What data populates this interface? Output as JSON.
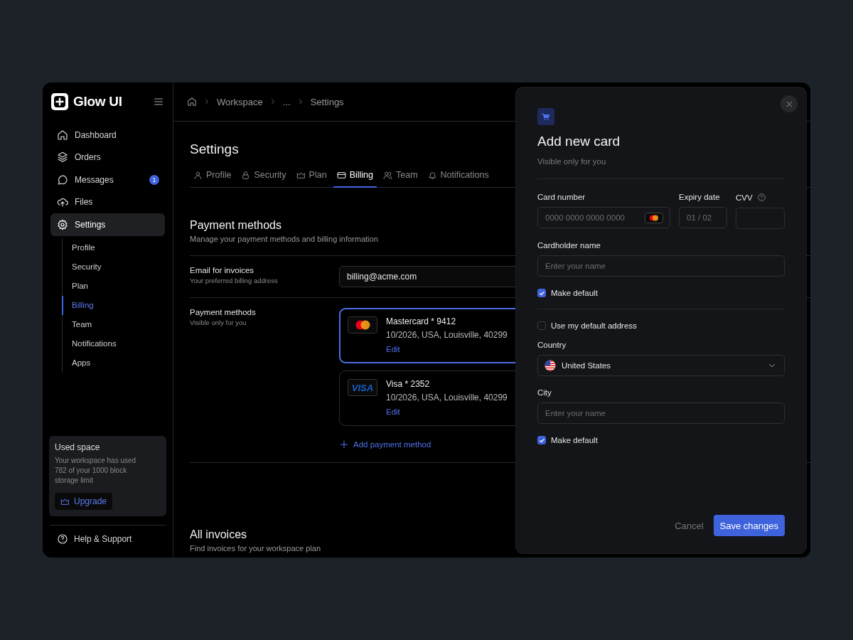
{
  "brand": {
    "name": "Glow UI"
  },
  "nav": [
    {
      "label": "Dashboard",
      "selected": false
    },
    {
      "label": "Orders",
      "selected": false
    },
    {
      "label": "Messages",
      "selected": false,
      "badge": "1"
    },
    {
      "label": "Files",
      "selected": false
    },
    {
      "label": "Settings",
      "selected": true
    }
  ],
  "subnav": [
    {
      "label": "Profile",
      "selected": false
    },
    {
      "label": "Security",
      "selected": false
    },
    {
      "label": "Plan",
      "selected": false
    },
    {
      "label": "Billing",
      "selected": true
    },
    {
      "label": "Team",
      "selected": false
    },
    {
      "label": "Notifications",
      "selected": false
    },
    {
      "label": "Apps",
      "selected": false
    }
  ],
  "usage_card": {
    "title": "Used space",
    "text": "Your workspace has used 782 of your 1000 block storage limit",
    "button": "Upgrade"
  },
  "help": "Help & Support",
  "breadcrumb": [
    "Workspace",
    "...",
    "Settings"
  ],
  "page_title": "Settings",
  "tabs": [
    {
      "label": "Profile",
      "selected": false
    },
    {
      "label": "Security",
      "selected": false
    },
    {
      "label": "Plan",
      "selected": false
    },
    {
      "label": "Billing",
      "selected": true
    },
    {
      "label": "Team",
      "selected": false
    },
    {
      "label": "Notifications",
      "selected": false
    }
  ],
  "payment_section": {
    "title": "Payment methods",
    "subtitle": "Manage your payment methods and billing information",
    "email_row": {
      "label": "Email for invoices",
      "hint": "Your preferred billing address",
      "value": "billing@acme.com"
    },
    "methods_row": {
      "label": "Payment methods",
      "hint": "Visible only for you",
      "cards": [
        {
          "kind": "mastercard",
          "name": "Mastercard * 9412",
          "details": "10/2026, USA, Louisville, 40299",
          "action": "Edit",
          "selected": true
        },
        {
          "kind": "visa",
          "logo_text": "VISA",
          "name": "Visa * 2352",
          "details": "10/2026, USA, Louisville, 40299",
          "action": "Edit",
          "selected": false
        }
      ],
      "add_button": "Add payment method"
    }
  },
  "invoices_section": {
    "title": "All invoices",
    "subtitle": "Find invoices for your workspace plan"
  },
  "dialog": {
    "title": "Add new card",
    "subtitle": "Visible only for you",
    "card_number": {
      "label": "Card number",
      "placeholder": "0000 0000 0000 0000"
    },
    "expiry_date": {
      "label": "Expiry date",
      "placeholder": "01 / 02"
    },
    "cvv": {
      "label": "CVV"
    },
    "cardholder_name": {
      "label": "Cardholder name",
      "placeholder": "Enter your name"
    },
    "card_default": {
      "label": "Make default",
      "checked": true
    },
    "use_default_address": {
      "label": "Use my default address",
      "checked": false
    },
    "country": {
      "label": "Country",
      "value": "United States"
    },
    "city": {
      "label": "City",
      "placeholder": "Enter your name"
    },
    "address_default": {
      "label": "Make default",
      "checked": true
    },
    "buttons": [
      {
        "label": "Cancel",
        "kind": "secondary"
      },
      {
        "label": "Save changes",
        "kind": "primary"
      }
    ]
  }
}
